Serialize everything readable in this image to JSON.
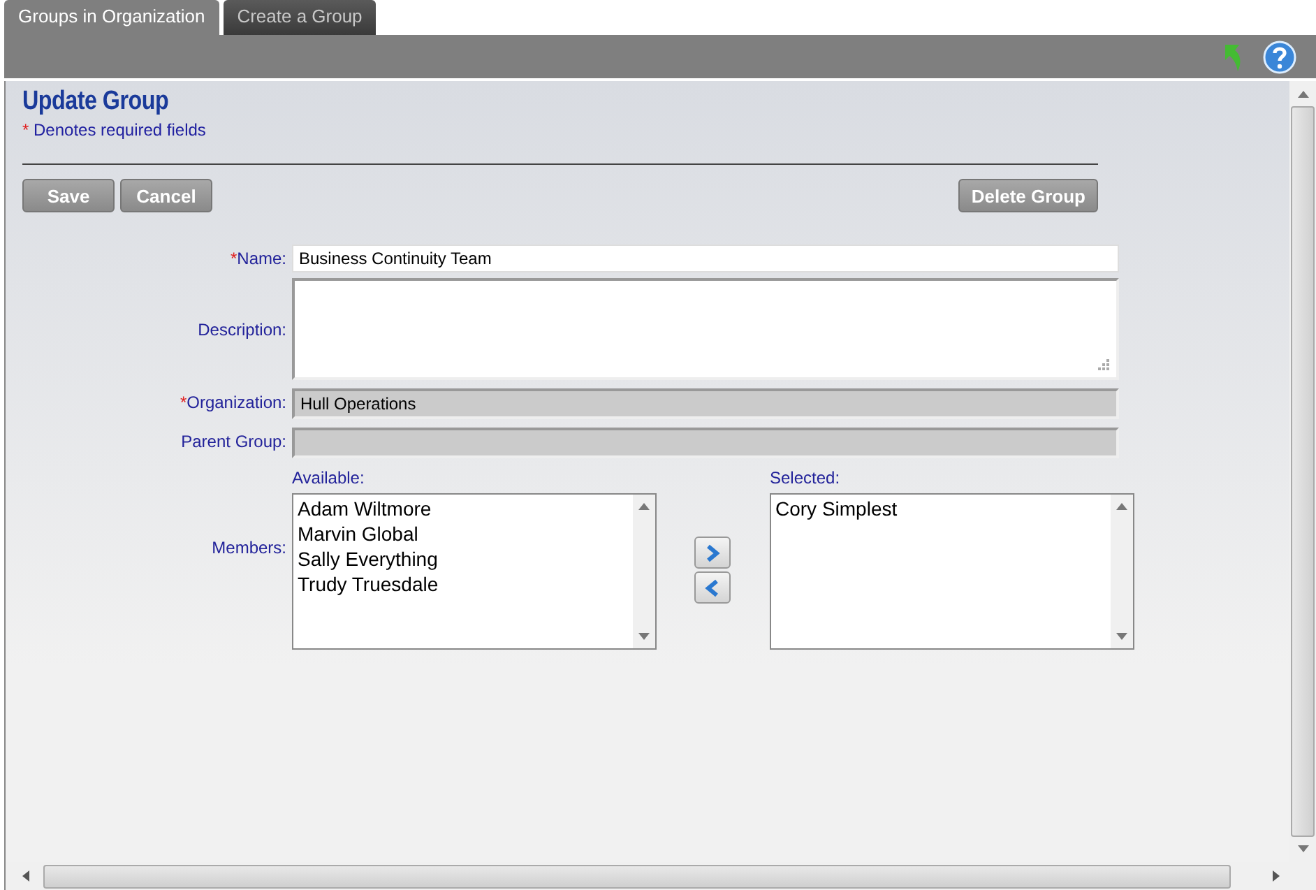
{
  "tabs": [
    {
      "label": "Groups in Organization",
      "selected": true
    },
    {
      "label": "Create a Group",
      "selected": false
    }
  ],
  "form": {
    "title": "Update Group",
    "required_mark": "*",
    "required_note": "Denotes required fields",
    "buttons": [
      {
        "label": "Save",
        "kind": "left"
      },
      {
        "label": "Cancel",
        "kind": "left"
      },
      {
        "label": "Delete Group",
        "kind": "right"
      }
    ],
    "fields": [
      {
        "label": "Name:",
        "required": true,
        "kind": "text",
        "value": "Business Continuity Team"
      },
      {
        "label": "Description:",
        "required": false,
        "kind": "textarea"
      },
      {
        "label": "Organization:",
        "required": true,
        "kind": "readonly",
        "value": "Hull Operations"
      },
      {
        "label": "Parent Group:",
        "required": false,
        "kind": "readonly"
      }
    ],
    "members": {
      "label": "Members:",
      "available_label": "Available:",
      "available": [
        "Adam Wiltmore",
        "Marvin Global",
        "Sally Everything",
        "Trudy Truesdale"
      ],
      "selected_label": "Selected:",
      "selected": [
        "Cory Simplest"
      ]
    }
  }
}
